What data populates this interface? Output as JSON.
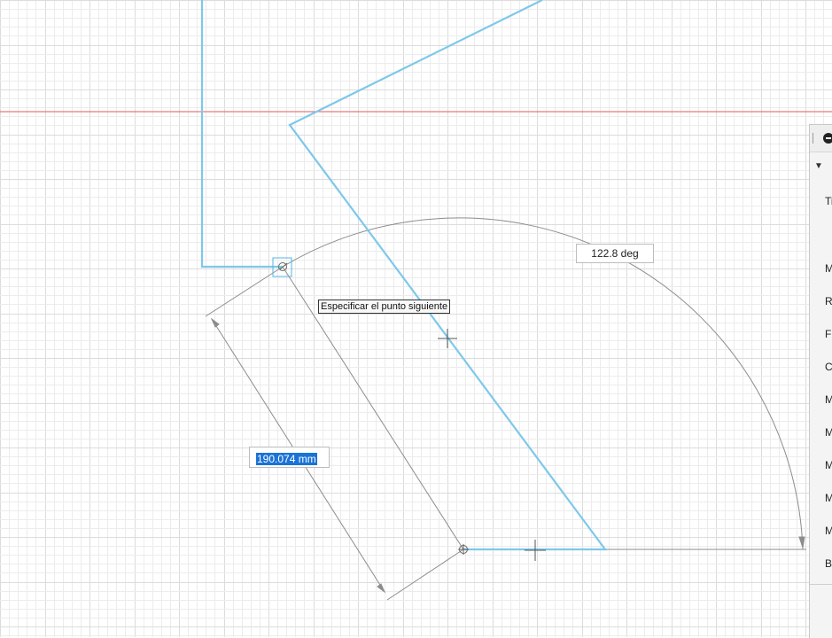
{
  "tooltip": {
    "text": "Especificar el punto siguiente"
  },
  "dimensions": {
    "angle": "122.8 deg",
    "length": "190.074 mm"
  },
  "panel": {
    "rows": [
      "Ti",
      "M",
      "R",
      "F",
      "C",
      "M",
      "M",
      "M",
      "M",
      "M",
      "B"
    ]
  },
  "colors": {
    "sketch_line": "#7ec8ea",
    "dimension_line": "#8c8c8c",
    "axis_line": "#e05a5a",
    "grid_minor": "#ececec",
    "grid_major": "#dcdcdc",
    "selection": "#1a73d6"
  }
}
